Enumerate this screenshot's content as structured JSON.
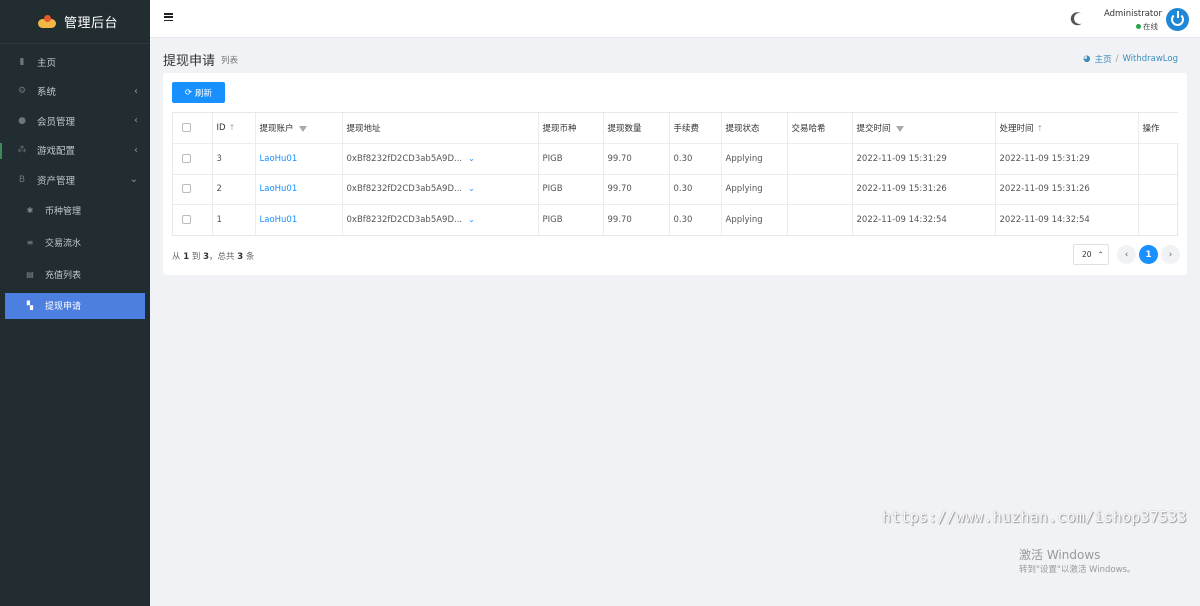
{
  "brand": {
    "title": "管理后台"
  },
  "sidebar": {
    "items": [
      {
        "label": "主页",
        "icon": "chart-icon",
        "has_children": false
      },
      {
        "label": "系统",
        "icon": "gear-icon",
        "has_children": true
      },
      {
        "label": "会员管理",
        "icon": "user-icon",
        "has_children": true
      },
      {
        "label": "游戏配置",
        "icon": "game-icon",
        "has_children": true
      },
      {
        "label": "资产管理",
        "icon": "bitcoin-icon",
        "has_children": true,
        "expanded": true
      }
    ],
    "sub_items": [
      {
        "label": "币种管理",
        "icon": "cog-icon"
      },
      {
        "label": "交易流水",
        "icon": "list-icon"
      },
      {
        "label": "充值列表",
        "icon": "table-icon"
      },
      {
        "label": "提现申请",
        "icon": "document-icon",
        "active": true
      }
    ],
    "active_color": "#4d7fe0"
  },
  "header": {
    "user_name": "Administrator",
    "user_status": "在线"
  },
  "page": {
    "title": "提现申请",
    "subtitle": "列表"
  },
  "breadcrumb": {
    "home": "主页",
    "sep": "/",
    "current": "WithdrawLog"
  },
  "toolbar": {
    "refresh_label": "刷新"
  },
  "table": {
    "columns": [
      "ID",
      "提现账户",
      "提现地址",
      "提现币种",
      "提现数量",
      "手续费",
      "提现状态",
      "交易哈希",
      "提交时间",
      "处理时间",
      "操作"
    ],
    "rows": [
      {
        "id": "3",
        "account": "LaoHu01",
        "address": "0xBf8232fD2CD3ab5A9D...",
        "coin": "PIGB",
        "amount": "99.70",
        "fee": "0.30",
        "status": "Applying",
        "hash": "",
        "submit_time": "2022-11-09 15:31:29",
        "process_time": "2022-11-09 15:31:29",
        "action": ""
      },
      {
        "id": "2",
        "account": "LaoHu01",
        "address": "0xBf8232fD2CD3ab5A9D...",
        "coin": "PIGB",
        "amount": "99.70",
        "fee": "0.30",
        "status": "Applying",
        "hash": "",
        "submit_time": "2022-11-09 15:31:26",
        "process_time": "2022-11-09 15:31:26",
        "action": ""
      },
      {
        "id": "1",
        "account": "LaoHu01",
        "address": "0xBf8232fD2CD3ab5A9D...",
        "coin": "PIGB",
        "amount": "99.70",
        "fee": "0.30",
        "status": "Applying",
        "hash": "",
        "submit_time": "2022-11-09 14:32:54",
        "process_time": "2022-11-09 14:32:54",
        "action": ""
      }
    ]
  },
  "pagination": {
    "summary_prefix": "从",
    "from": "1",
    "summary_to": "到",
    "to": "3",
    "summary_total": "，总共",
    "total": "3",
    "summary_unit": "条",
    "page_size": "20",
    "current_page": "1"
  },
  "watermark": {
    "url": "https://www.huzhan.com/ishop37533",
    "activate_title": "激活 Windows",
    "activate_hint": "转到\"设置\"以激活 Windows。"
  },
  "colors": {
    "primary": "#1890ff",
    "sidebar_bg": "#222d32",
    "online": "#28a745"
  }
}
